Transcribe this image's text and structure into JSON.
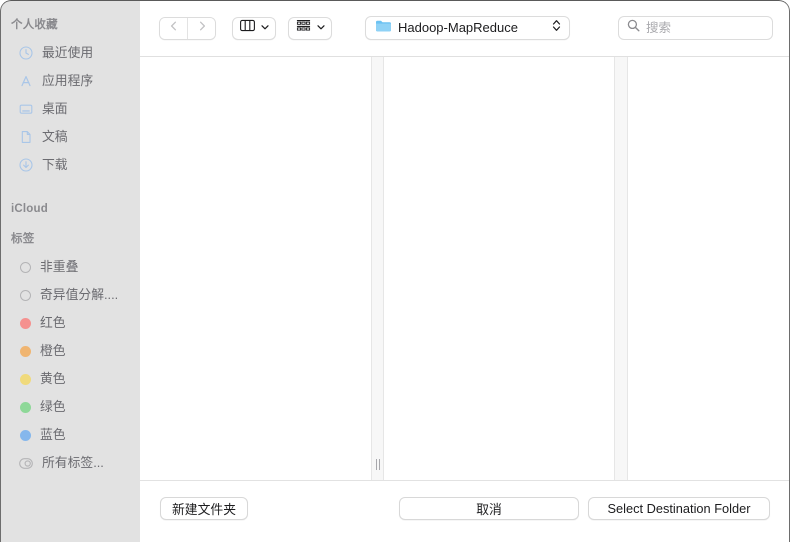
{
  "window": {
    "title": "Hadoop-MapReduce"
  },
  "sidebar": {
    "sections": [
      {
        "title": "个人收藏",
        "items": [
          {
            "label": "最近使用",
            "icon": "clock-icon"
          },
          {
            "label": "应用程序",
            "icon": "applications-icon"
          },
          {
            "label": "桌面",
            "icon": "desktop-icon"
          },
          {
            "label": "文稿",
            "icon": "document-icon"
          },
          {
            "label": "下载",
            "icon": "download-icon"
          }
        ]
      },
      {
        "title": "iCloud",
        "items": []
      },
      {
        "title": "标签",
        "items": [
          {
            "label": "非重叠",
            "icon": "tag-dot-icon",
            "color": "none"
          },
          {
            "label": "奇异值分解....",
            "icon": "tag-dot-icon",
            "color": "none"
          },
          {
            "label": "红色",
            "icon": "tag-dot-icon",
            "color": "#f5918f"
          },
          {
            "label": "橙色",
            "icon": "tag-dot-icon",
            "color": "#f0b571"
          },
          {
            "label": "黄色",
            "icon": "tag-dot-icon",
            "color": "#f0da7c"
          },
          {
            "label": "绿色",
            "icon": "tag-dot-icon",
            "color": "#8ed898"
          },
          {
            "label": "蓝色",
            "icon": "tag-dot-icon",
            "color": "#85b7ec"
          },
          {
            "label": "所有标签...",
            "icon": "all-tags-icon",
            "color": "none"
          }
        ]
      }
    ]
  },
  "toolbar": {
    "back_icon": "chevron-left-icon",
    "forward_icon": "chevron-right-icon",
    "view_icon": "column-view-icon",
    "view_chevron_icon": "chevron-down-icon",
    "arrange_icon": "group-by-icon",
    "arrange_chevron_icon": "chevron-down-icon",
    "path_folder_icon": "folder-icon",
    "path_value": "Hadoop-MapReduce",
    "path_stepper_icon": "up-down-chevron-icon",
    "search_icon": "search-icon",
    "search_placeholder": "搜索",
    "search_value": ""
  },
  "bottom_bar": {
    "new_folder_label": "新建文件夹",
    "cancel_label": "取消",
    "select_label": "Select Destination Folder"
  },
  "colors": {
    "sidebar_bg": "#e2e2e2",
    "content_bg": "#ffffff",
    "sidebar_text": "#6b6b70",
    "section_title": "#8a8a8e",
    "folder_blue": "#68c0f0"
  }
}
